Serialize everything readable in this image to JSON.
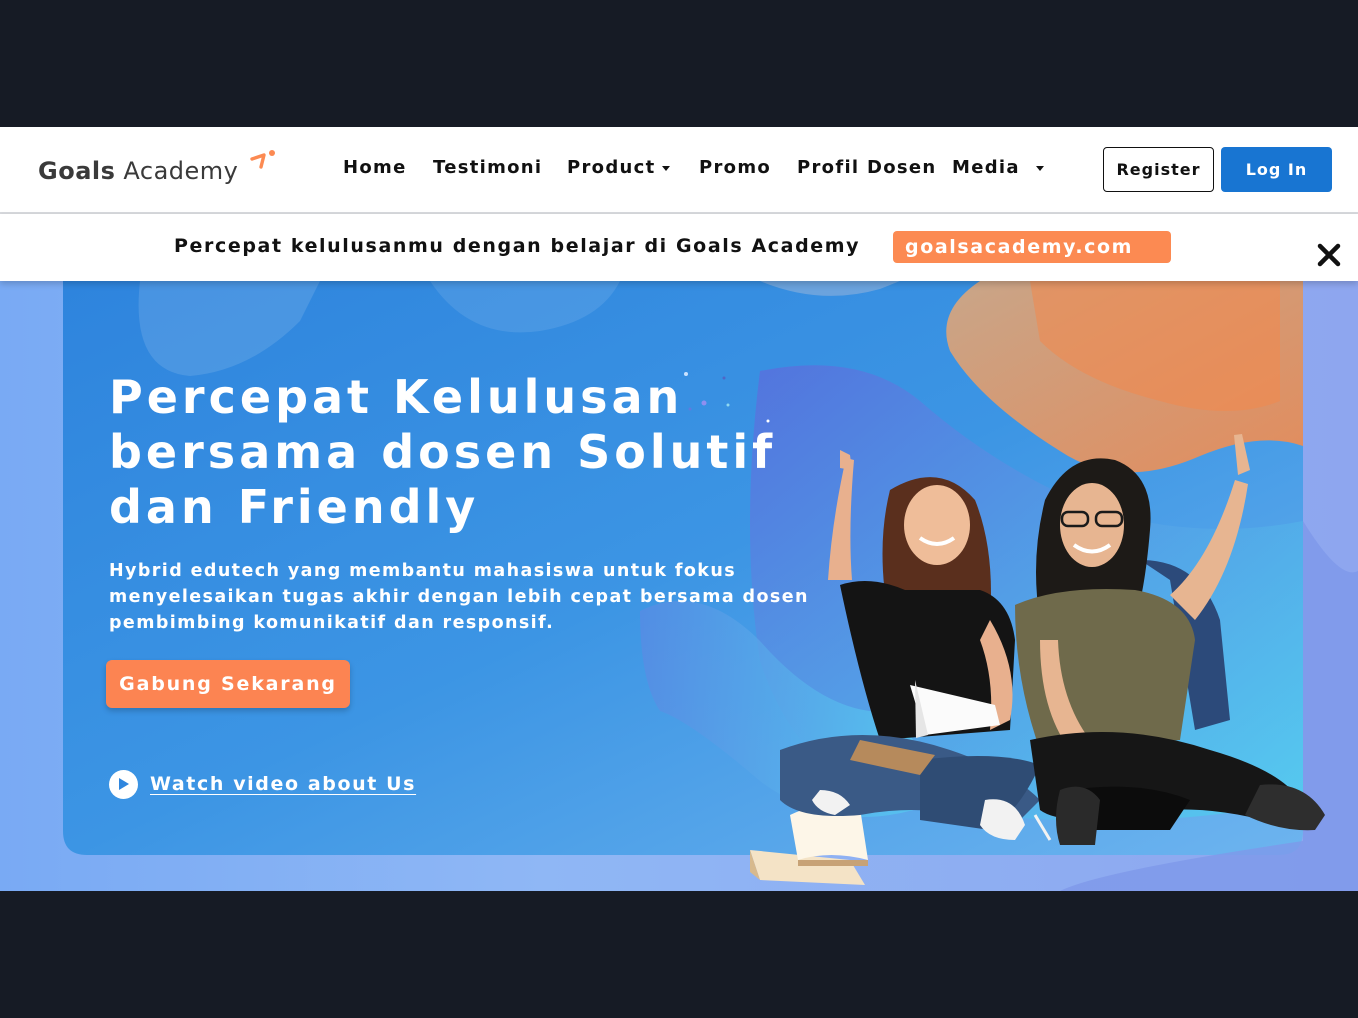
{
  "brand": {
    "name_bold": "Goals",
    "name_regular": "Academy",
    "accent_color": "#fc8a52",
    "primary_color": "#1875d2"
  },
  "nav": {
    "items": [
      {
        "label": "Home",
        "has_dropdown": false
      },
      {
        "label": "Testimoni",
        "has_dropdown": false
      },
      {
        "label": "Product",
        "has_dropdown": true
      },
      {
        "label": "Promo",
        "has_dropdown": false
      },
      {
        "label": "Profil Dosen",
        "has_dropdown": false
      },
      {
        "label": "Media",
        "has_dropdown": true
      }
    ],
    "register_label": "Register",
    "login_label": "Log In"
  },
  "promo_bar": {
    "text": "Percepat kelulusanmu dengan belajar di Goals Academy",
    "link_label": "goalsacademy.com",
    "close_icon": "close-icon"
  },
  "hero": {
    "title_lines": [
      "Percepat Kelulusan",
      "bersama dosen Solutif",
      "dan Friendly"
    ],
    "description_lines": [
      "Hybrid edutech yang membantu mahasiswa untuk fokus",
      "menyelesaikan tugas akhir dengan lebih cepat bersama dosen",
      "pembimbing komunikatif dan responsif."
    ],
    "cta_label": "Gabung Sekarang",
    "watch_label": "Watch video about Us",
    "watch_icon": "play-icon"
  }
}
